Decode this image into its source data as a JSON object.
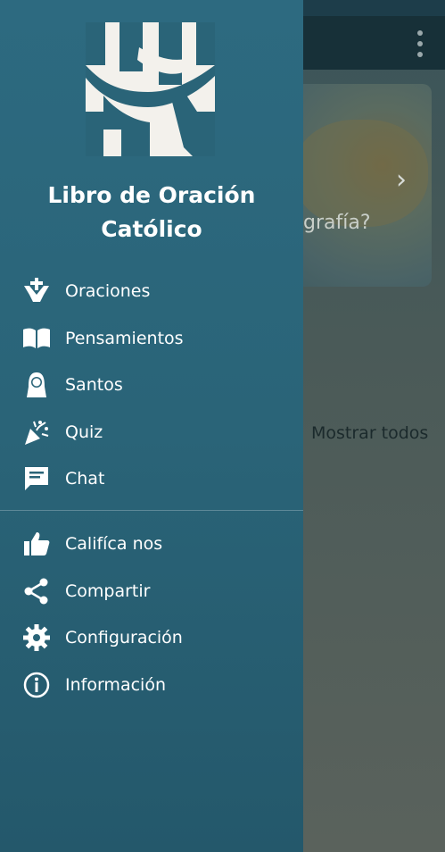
{
  "app": {
    "name_line1": "Libro de Oración",
    "name_line2": "Católico"
  },
  "background": {
    "card_title": "grafía?",
    "card_arrow": "›",
    "show_all": "Mostrar todos"
  },
  "menu_primary": [
    {
      "label": "Oraciones",
      "icon": "praying-hands-icon"
    },
    {
      "label": "Pensamientos",
      "icon": "open-book-icon"
    },
    {
      "label": "Santos",
      "icon": "nun-icon"
    },
    {
      "label": "Quiz",
      "icon": "confetti-icon"
    },
    {
      "label": "Chat",
      "icon": "chat-icon"
    }
  ],
  "menu_secondary": [
    {
      "label": "Califíca nos",
      "icon": "thumbs-up-icon"
    },
    {
      "label": "Compartir",
      "icon": "share-icon"
    },
    {
      "label": "Configuración",
      "icon": "gear-icon"
    },
    {
      "label": "Información",
      "icon": "info-icon"
    }
  ],
  "colors": {
    "drawer": "#2a6478",
    "toolbar": "#173038",
    "text": "#ffffff"
  }
}
